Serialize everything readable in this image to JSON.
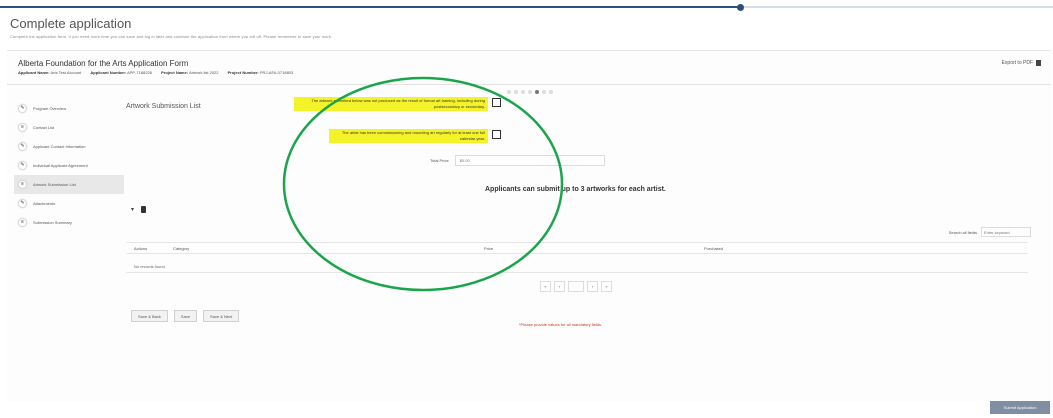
{
  "page": {
    "title": "Complete application",
    "instructions": "Complete the application form. If you need more time you can save and log in later and continue the application from where you left off. Please remember to save your work."
  },
  "form": {
    "title": "Alberta Foundation for the Arts Application Form",
    "meta": [
      {
        "label": "Applicant Name:",
        "value": "Arts Test Account"
      },
      {
        "label": "Applicant Number:",
        "value": "APP-7188226"
      },
      {
        "label": "Project Name:",
        "value": "Artwork list 2022"
      },
      {
        "label": "Project Number:",
        "value": "PRJ-AFA-0718803"
      }
    ],
    "export_label": "Export to PDF",
    "export_icon": "pdf-icon"
  },
  "stepper": {
    "total": 7,
    "active": 5
  },
  "sidebar": {
    "items": [
      {
        "label": "Program Overview",
        "icon": "pencil-icon",
        "active": false
      },
      {
        "label": "Contact List",
        "icon": "list-icon",
        "active": false
      },
      {
        "label": "Applicant Contact Information",
        "icon": "pencil-icon",
        "active": false
      },
      {
        "label": "Individual Applicant Agreement",
        "icon": "pencil-icon",
        "active": false
      },
      {
        "label": "Artwork Submission List",
        "icon": "list-icon",
        "active": true
      },
      {
        "label": "Attachments",
        "icon": "pencil-icon",
        "active": false
      },
      {
        "label": "Submission Summary",
        "icon": "list-icon",
        "active": false
      }
    ]
  },
  "main": {
    "section_title": "Artwork Submission List",
    "declarations": [
      {
        "text": "The artwork submitted below was not produced as the result of formal art training, including during postsecondary or secondary.",
        "checked": false
      },
      {
        "text": "The artist has been commissioning and mounting art regularly for at least one full calendar year.",
        "checked": false
      }
    ],
    "total_price": {
      "label": "Total Price",
      "placeholder": "$0.00"
    },
    "applicant_note": "Applicants can submit up to 3 artworks for each artist.",
    "grid": {
      "search_label": "Search all fields",
      "search_placeholder": "Enter keyword",
      "columns": [
        "Actions",
        "Category",
        "Price",
        "Purchased"
      ],
      "empty_text": "No records found."
    },
    "pager": [
      "«",
      "‹",
      "",
      "›",
      "»"
    ],
    "buttons": [
      "Save & Back",
      "Save",
      "Save & Next"
    ],
    "required_note": "*Please provide values for all mandatory fields."
  },
  "footer": {
    "submit_label": "Submit Application"
  },
  "colors": {
    "highlight": "#f4f32a",
    "annotation": "#1aa54a",
    "progress": "#2c4f7a",
    "submit": "#7f8ea3",
    "required": "#c0392b"
  }
}
